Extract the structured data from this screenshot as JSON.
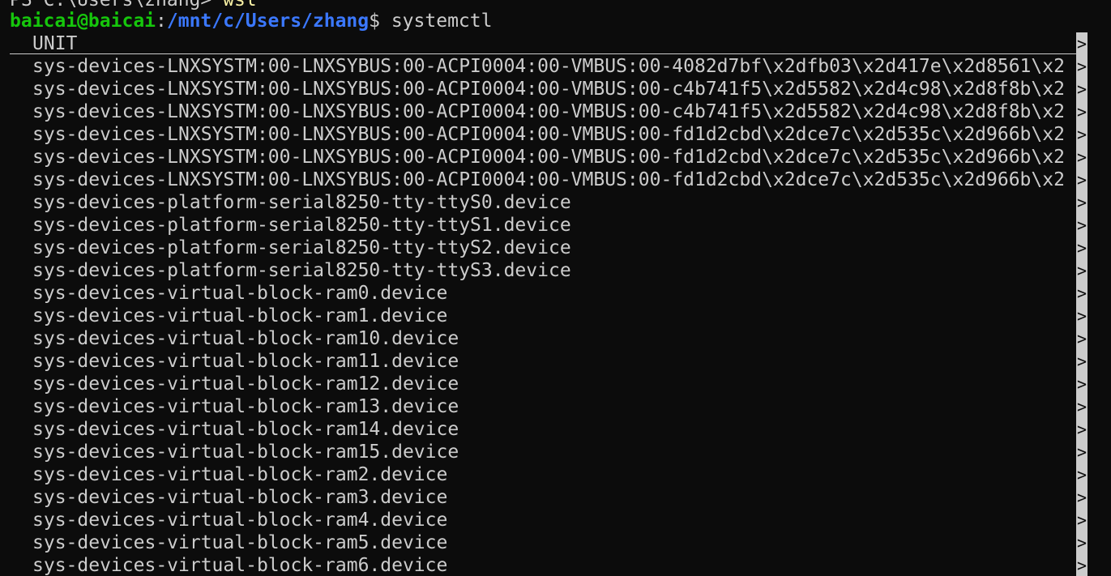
{
  "previous_line": {
    "prompt": "PS C:\\Users\\zhang> ",
    "command": "wsl"
  },
  "prompt": {
    "user_host": "baicai@baicai",
    "separator": ":",
    "path": "/mnt/c/Users/zhang",
    "symbol": "$ ",
    "command": "systemctl"
  },
  "table": {
    "header": "UNIT",
    "truncation_marker": ">",
    "rows": [
      "sys-devices-LNXSYSTM:00-LNXSYBUS:00-ACPI0004:00-VMBUS:00-4082d7bf\\x2dfb03\\x2d417e\\x2d8561\\x2",
      "sys-devices-LNXSYSTM:00-LNXSYBUS:00-ACPI0004:00-VMBUS:00-c4b741f5\\x2d5582\\x2d4c98\\x2d8f8b\\x2",
      "sys-devices-LNXSYSTM:00-LNXSYBUS:00-ACPI0004:00-VMBUS:00-c4b741f5\\x2d5582\\x2d4c98\\x2d8f8b\\x2",
      "sys-devices-LNXSYSTM:00-LNXSYBUS:00-ACPI0004:00-VMBUS:00-fd1d2cbd\\x2dce7c\\x2d535c\\x2d966b\\x2",
      "sys-devices-LNXSYSTM:00-LNXSYBUS:00-ACPI0004:00-VMBUS:00-fd1d2cbd\\x2dce7c\\x2d535c\\x2d966b\\x2",
      "sys-devices-LNXSYSTM:00-LNXSYBUS:00-ACPI0004:00-VMBUS:00-fd1d2cbd\\x2dce7c\\x2d535c\\x2d966b\\x2",
      "sys-devices-platform-serial8250-tty-ttyS0.device",
      "sys-devices-platform-serial8250-tty-ttyS1.device",
      "sys-devices-platform-serial8250-tty-ttyS2.device",
      "sys-devices-platform-serial8250-tty-ttyS3.device",
      "sys-devices-virtual-block-ram0.device",
      "sys-devices-virtual-block-ram1.device",
      "sys-devices-virtual-block-ram10.device",
      "sys-devices-virtual-block-ram11.device",
      "sys-devices-virtual-block-ram12.device",
      "sys-devices-virtual-block-ram13.device",
      "sys-devices-virtual-block-ram14.device",
      "sys-devices-virtual-block-ram15.device",
      "sys-devices-virtual-block-ram2.device",
      "sys-devices-virtual-block-ram3.device",
      "sys-devices-virtual-block-ram4.device",
      "sys-devices-virtual-block-ram5.device",
      "sys-devices-virtual-block-ram6.device"
    ]
  },
  "colors": {
    "background": "#0c0c0c",
    "foreground": "#cccccc",
    "user_host": "#16c60c",
    "path": "#3b78ff",
    "command_highlight": "#f9f1a5"
  }
}
